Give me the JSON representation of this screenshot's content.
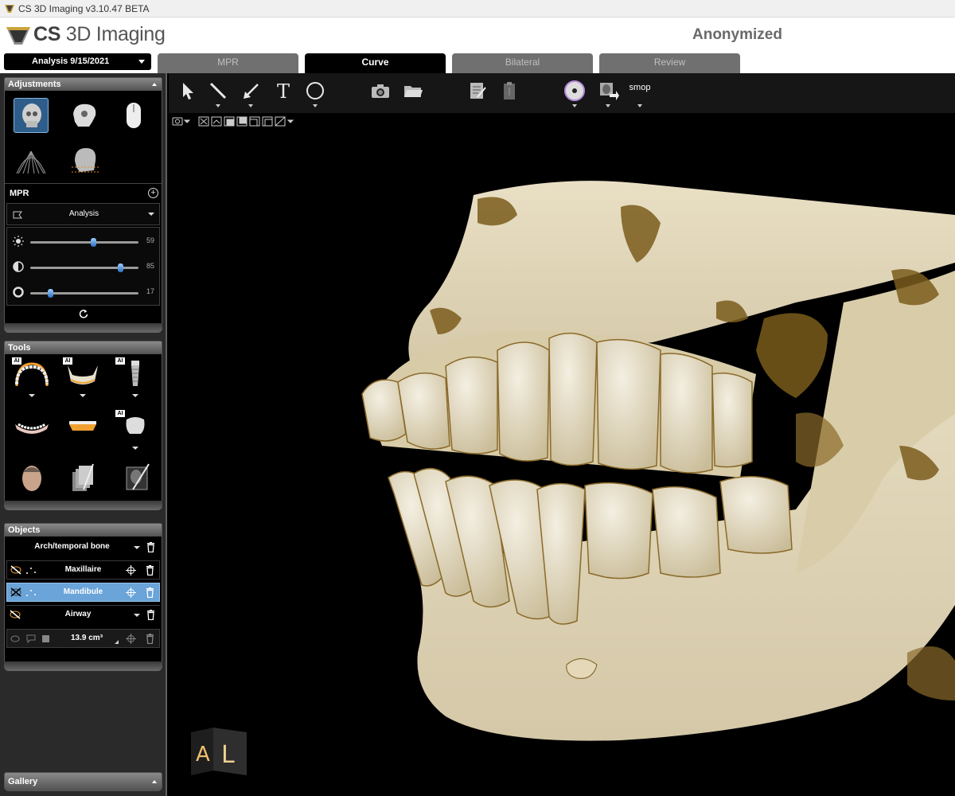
{
  "window": {
    "title": "CS 3D Imaging v3.10.47 BETA"
  },
  "header": {
    "logo_brand": "CS",
    "logo_product": "3D Imaging",
    "patient_name": "Anonymized"
  },
  "analysis_selector": {
    "label": "Analysis 9/15/2021"
  },
  "tabs": [
    {
      "label": "MPR",
      "active": false
    },
    {
      "label": "Curve",
      "active": true
    },
    {
      "label": "Bilateral",
      "active": false
    },
    {
      "label": "Review",
      "active": false
    }
  ],
  "adjustments": {
    "title": "Adjustments",
    "icons": [
      "skull-front-render-icon",
      "skull-side-render-icon",
      "mouse-icon",
      "panoramic-fan-icon",
      "head-profile-icon"
    ],
    "mpr": {
      "label": "MPR",
      "preset": "Analysis",
      "sliders": [
        {
          "name": "brightness",
          "icon": "sun-icon",
          "value": 59
        },
        {
          "name": "contrast",
          "icon": "contrast-icon",
          "value": 85
        },
        {
          "name": "gamma",
          "icon": "ring-icon",
          "value": 17
        }
      ]
    }
  },
  "tools": {
    "title": "Tools",
    "ai_badge": "AI"
  },
  "objects": {
    "title": "Objects",
    "group": "Arch/temporal bone",
    "items": [
      {
        "label": "Maxillaire",
        "selected": false
      },
      {
        "label": "Mandibule",
        "selected": true
      }
    ],
    "airway": {
      "label": "Airway",
      "volume": "13.9 cm³"
    }
  },
  "toolbar": {
    "smop_label": "smop"
  },
  "orientation": {
    "face_a": "A",
    "face_l": "L"
  },
  "gallery": {
    "title": "Gallery"
  },
  "colors": {
    "selection_blue": "#6aa4d8",
    "bone": "#e6dcc0",
    "bone_shadow": "#7a5c1c"
  }
}
